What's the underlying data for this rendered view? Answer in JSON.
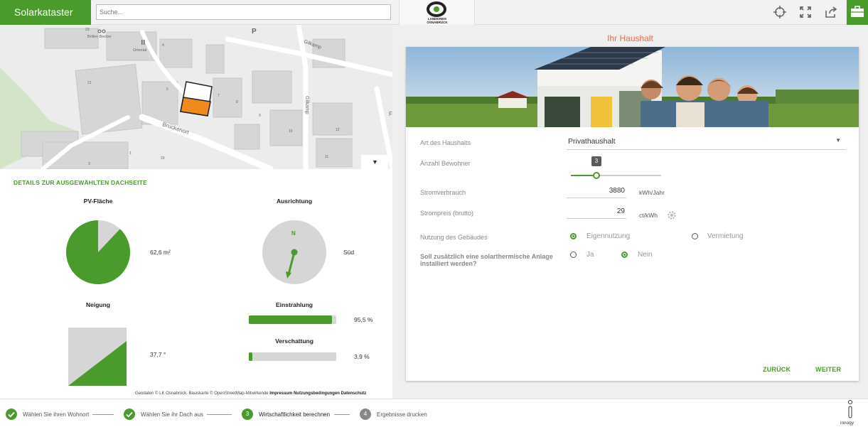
{
  "topbar": {
    "brand": "Solarkataster",
    "search_placeholder": "Suche...",
    "logo_text_1": "LANDKREIS",
    "logo_text_2": "OSNABRÜCK",
    "icons": [
      "crosshair-icon",
      "fullscreen-icon",
      "share-icon",
      "toolbox-icon"
    ]
  },
  "map": {
    "labels": {
      "p": "P",
      "gilkamp1": "Gilkamp",
      "gilkamp2": "Gilkamp",
      "bruckenort": "Bruckenort",
      "brillen": "Brillen Becker",
      "oriental": "Oriental",
      "n23": "23",
      "n4": "4",
      "n21": "21",
      "n5": "5",
      "n7": "7",
      "n8": "8",
      "n9": "9",
      "n10": "10",
      "n12": "12",
      "n11": "11",
      "n1": "1",
      "n3": "3",
      "n20": "20",
      "f": "F"
    }
  },
  "details": {
    "title": "DETAILS ZUR AUSGEWÄHLTEN DACHSEITE",
    "pv_label": "PV-Fläche",
    "pv_value": "62,6 m²",
    "ausrichtung_label": "Ausrichtung",
    "compass_n": "N",
    "ausrichtung_value": "Süd",
    "neigung_label": "Neigung",
    "neigung_value": "37,7 °",
    "einstrahlung_label": "Einstrahlung",
    "einstrahlung_value": "95,5 %",
    "einstrahlung_fraction": 0.955,
    "verschattung_label": "Verschattung",
    "verschattung_value": "3,9 %",
    "verschattung_fraction": 0.039,
    "footnote_plain": "Geodaten © LK Osnabrück, Basiskarte © OpenStreetMap-Mitwirkende",
    "footnote_impressum": "Impressum",
    "footnote_nutzung": "Nutzungsbedingungen",
    "footnote_datenschutz": "Datenschutz"
  },
  "form": {
    "title": "Ihr Haushalt",
    "art_label": "Art des Haushalts",
    "art_value": "Privathaushalt",
    "bewohner_label": "Anzahl Bewohner",
    "bewohner_value": "3",
    "strom_label": "Stromverbrauch",
    "strom_value": "3880",
    "strom_unit": "kWh/Jahr",
    "preis_label": "Strompreis (brutto)",
    "preis_value": "29",
    "preis_unit": "ct/kWh",
    "nutzung_label": "Nutzung des Gebäudes",
    "nutzung_opt1": "Eigennutzung",
    "nutzung_opt2": "Vermietung",
    "solar_label_1": "Soll zusätzlich eine solarthermische Anlage",
    "solar_label_2": "installiert werden?",
    "solar_opt1": "Ja",
    "solar_opt2": "Nein",
    "back": "ZURÜCK",
    "next": "WEITER"
  },
  "steps": [
    {
      "num": "",
      "label": "Wählen Sie ihren Wohnort",
      "state": "done"
    },
    {
      "num": "",
      "label": "Wählen Sie ihr Dach aus",
      "state": "done"
    },
    {
      "num": "3",
      "label": "Wirtschaftlichkeit berechnen",
      "state": "active"
    },
    {
      "num": "4",
      "label": "Ergebnisse drucken",
      "state": "todo"
    }
  ],
  "footer_brand": "innogy",
  "colors": {
    "accent": "#4a9a2c",
    "title": "#e36d52",
    "roof": "#f08a1c"
  }
}
